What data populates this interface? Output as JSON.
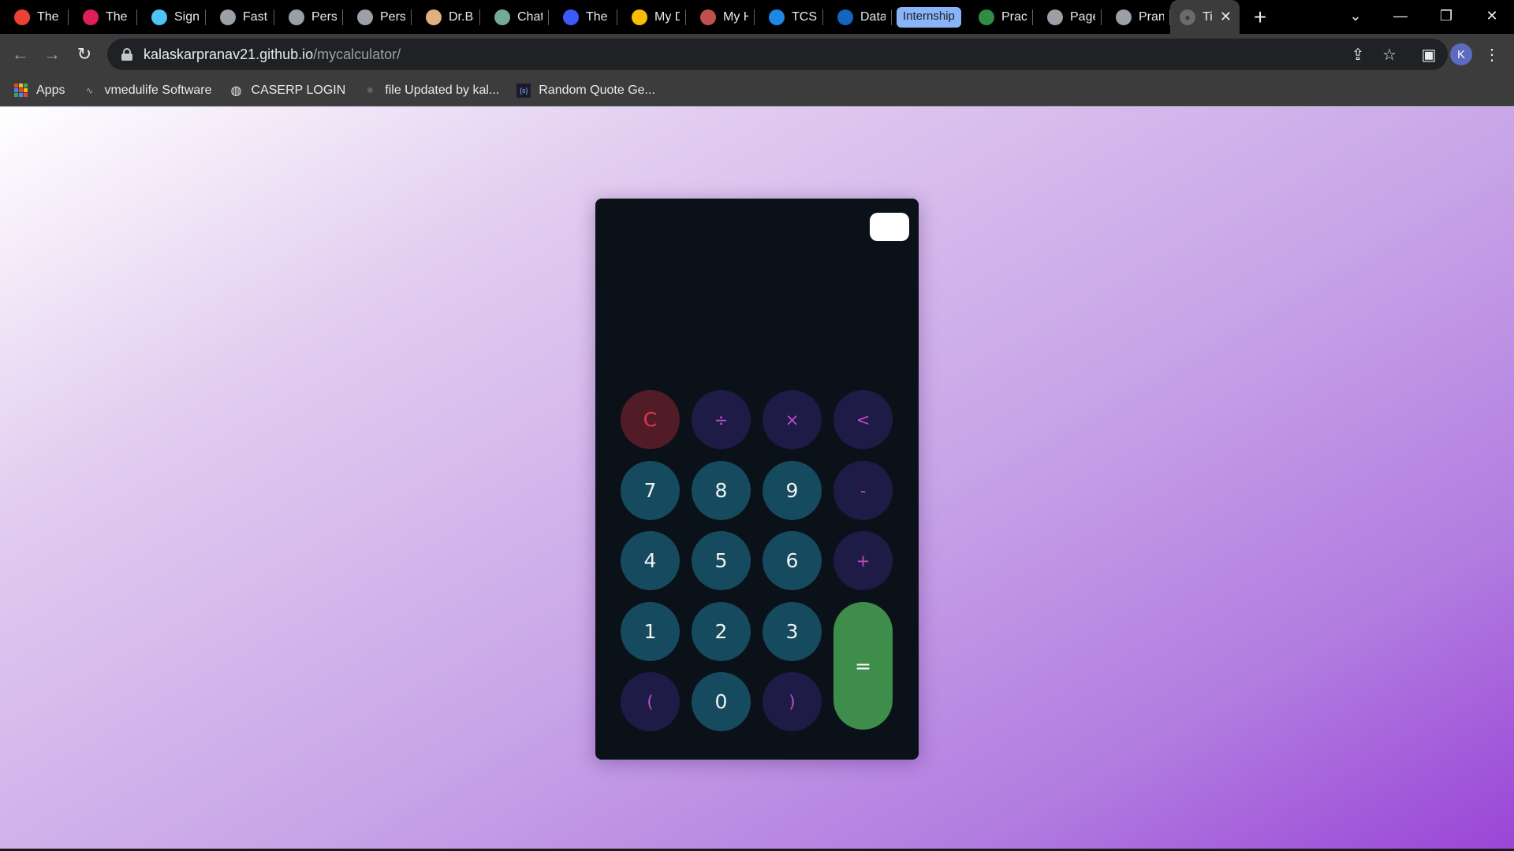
{
  "browser": {
    "tabs": [
      {
        "title": "The S",
        "icon": "gmail-icon",
        "color": "#ea4335"
      },
      {
        "title": "The S",
        "icon": "slack-icon",
        "color": "#e01e5a"
      },
      {
        "title": "Sign i",
        "icon": "sign-icon",
        "color": "#4fc3f7"
      },
      {
        "title": "Faste",
        "icon": "github-icon",
        "color": "#9aa0a6"
      },
      {
        "title": "Perso",
        "icon": "globe-icon",
        "color": "#9aa0a6"
      },
      {
        "title": "Perso",
        "icon": "globe-icon",
        "color": "#9aa0a6"
      },
      {
        "title": "Dr.Ba",
        "icon": "portrait-icon",
        "color": "#e0b080"
      },
      {
        "title": "ChatG",
        "icon": "chatgpt-icon",
        "color": "#74aa9c"
      },
      {
        "title": "The b",
        "icon": "b-icon",
        "color": "#3d5afe"
      },
      {
        "title": "My D",
        "icon": "drive-icon",
        "color": "#fbbc04"
      },
      {
        "title": "My H",
        "icon": "image-icon",
        "color": "#c0504d"
      },
      {
        "title": "TCS i",
        "icon": "power-icon",
        "color": "#1e88e5"
      },
      {
        "title": "Data",
        "icon": "s-icon",
        "color": "#1565c0"
      }
    ],
    "group_label": "Internship",
    "tabs_after": [
      {
        "title": "Pract",
        "icon": "gfg-icon",
        "color": "#2f8d46"
      },
      {
        "title": "Page:",
        "icon": "github-icon",
        "color": "#9aa0a6"
      },
      {
        "title": "Prana",
        "icon": "globe-icon",
        "color": "#9aa0a6"
      }
    ],
    "active_tab": {
      "title": "Ti",
      "icon": "globe-icon"
    },
    "url_host": "kalaskarpranav21.github.io",
    "url_path": "/mycalculator/",
    "profile_initial": "K",
    "bookmarks": [
      {
        "label": "Apps",
        "icon": "apps-icon"
      },
      {
        "label": "vmedulife Software",
        "icon": "vmedulife-icon"
      },
      {
        "label": "CASERP LOGIN",
        "icon": "globe-icon"
      },
      {
        "label": "file Updated by kal...",
        "icon": "github-icon"
      },
      {
        "label": "Random Quote Ge...",
        "icon": "code-icon"
      }
    ]
  },
  "calculator": {
    "display": "",
    "keys": {
      "clear": "C",
      "divide": "÷",
      "multiply": "×",
      "backspace": "<",
      "seven": "7",
      "eight": "8",
      "nine": "9",
      "minus": "-",
      "four": "4",
      "five": "5",
      "six": "6",
      "plus": "+",
      "one": "1",
      "two": "2",
      "three": "3",
      "equals": "=",
      "open_paren": "(",
      "zero": "0",
      "close_paren": ")"
    },
    "colors": {
      "body": "#0b1118",
      "number_key": "#164a5e",
      "operator_key": "#1e1c47",
      "operator_text": "#c04bc8",
      "clear_key": "#511c26",
      "clear_text": "#e0344c",
      "equals_key": "#3f8d4b"
    }
  }
}
